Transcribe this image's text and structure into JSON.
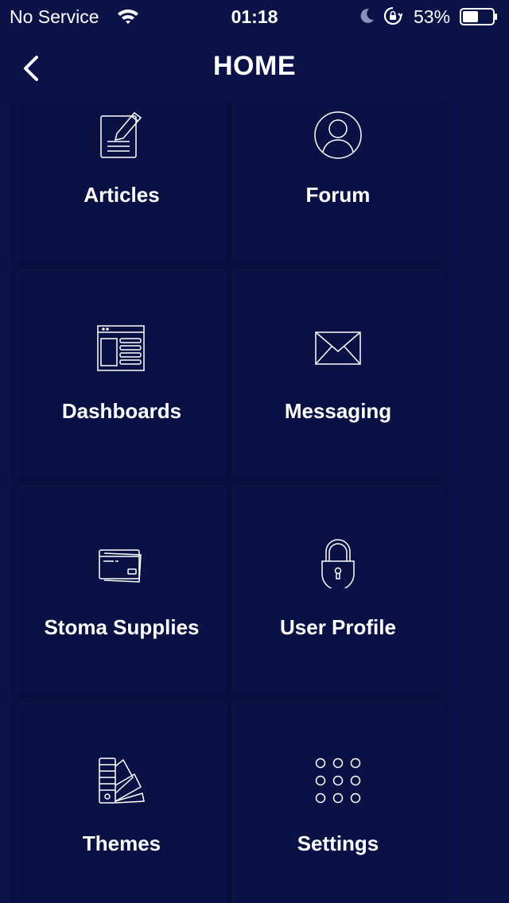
{
  "status_bar": {
    "carrier": "No Service",
    "time": "01:18",
    "battery_percent": "53%",
    "battery_level": 0.53
  },
  "nav": {
    "title": "HOME",
    "back_icon": "chevron-left-icon"
  },
  "tiles": [
    {
      "label": "Articles",
      "icon": "article-edit-icon"
    },
    {
      "label": "Forum",
      "icon": "user-circle-icon"
    },
    {
      "label": "Dashboards",
      "icon": "dashboard-window-icon"
    },
    {
      "label": "Messaging",
      "icon": "envelope-icon"
    },
    {
      "label": "Stoma Supplies",
      "icon": "credit-card-icon"
    },
    {
      "label": "User Profile",
      "icon": "padlock-icon"
    },
    {
      "label": "Themes",
      "icon": "color-swatch-icon"
    },
    {
      "label": "Settings",
      "icon": "dots-grid-icon"
    }
  ],
  "colors": {
    "background": "#0b1247",
    "tile": "#0a1145",
    "text": "#ffffff"
  }
}
